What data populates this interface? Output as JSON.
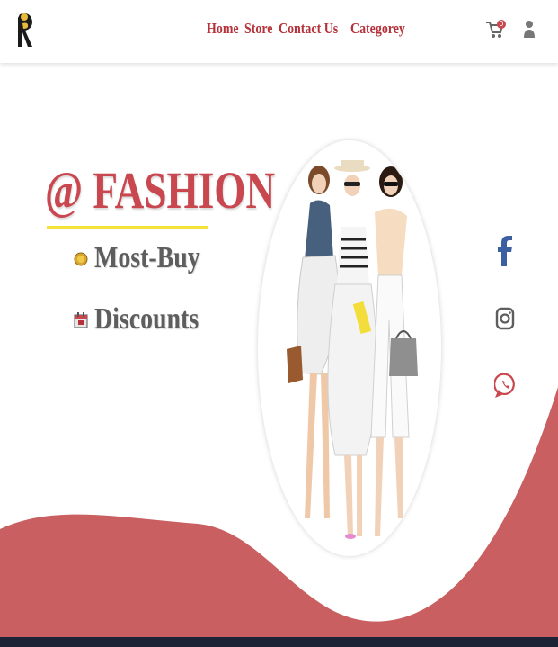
{
  "nav": {
    "links": [
      "Home",
      "Store",
      "Contact Us",
      "Categorey"
    ],
    "cart_badge": "0"
  },
  "hero": {
    "title": "@ FASHION",
    "items": [
      "Most-Buy",
      "Discounts"
    ]
  },
  "colors": {
    "brand": "#c9474f",
    "nav_text": "#b5323a",
    "underline": "#f2e23a",
    "item_text": "#5e5e5e",
    "wave": "#c95f60"
  },
  "icons": {
    "logo": "brand-logo-icon",
    "cart": "cart-icon",
    "user": "user-icon",
    "most_buy": "coin-icon",
    "discounts": "calendar-icon",
    "social": [
      "facebook-icon",
      "instagram-icon",
      "whatsapp-icon"
    ]
  }
}
